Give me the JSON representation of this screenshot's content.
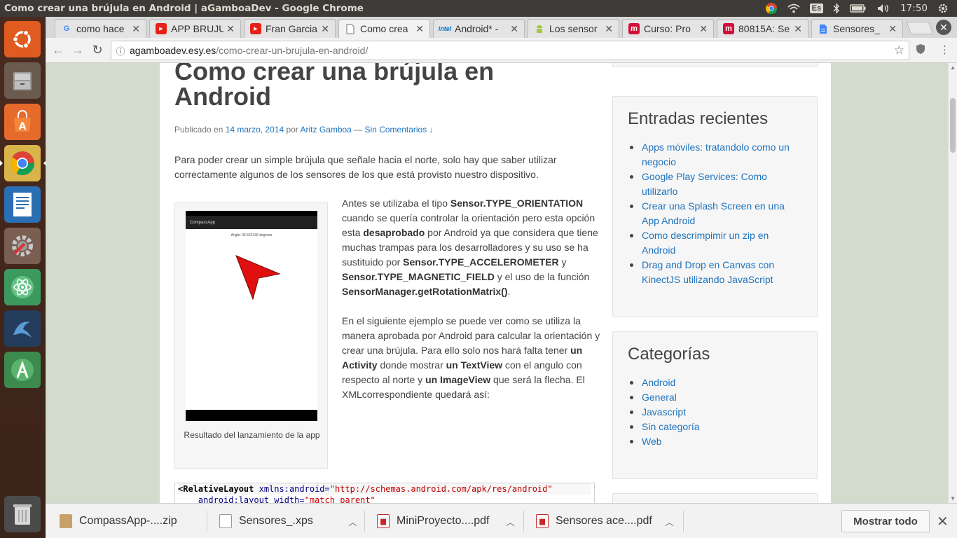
{
  "window": {
    "title": "Como crear una brújula en Android | aGamboaDev - Google Chrome"
  },
  "panel": {
    "keyboard_layout": "Es",
    "time": "17:50"
  },
  "launcher": {
    "apps": [
      {
        "name": "ubuntu-dash-icon"
      },
      {
        "name": "files-icon"
      },
      {
        "name": "software-center-icon"
      },
      {
        "name": "chrome-icon"
      },
      {
        "name": "libreoffice-writer-icon"
      },
      {
        "name": "system-settings-icon"
      },
      {
        "name": "atom-icon"
      },
      {
        "name": "mysql-workbench-icon"
      },
      {
        "name": "android-studio-icon"
      },
      {
        "name": "trash-icon"
      }
    ]
  },
  "tabs": [
    {
      "label": "como hace",
      "icon": "google-icon",
      "color": "#4285f4"
    },
    {
      "label": "APP BRUJU",
      "icon": "youtube-icon",
      "color": "#e62117"
    },
    {
      "label": "Fran Garcia",
      "icon": "youtube-icon",
      "color": "#e62117"
    },
    {
      "label": "Como crea",
      "icon": "page-icon",
      "color": "#777777",
      "active": true
    },
    {
      "label": "Android* -",
      "icon": "intel-icon",
      "color": "#0071c5"
    },
    {
      "label": "Los sensor",
      "icon": "android-icon",
      "color": "#a4c639"
    },
    {
      "label": "Curso: Pro",
      "icon": "m-icon",
      "color": "#d0103a"
    },
    {
      "label": "80815A: Se",
      "icon": "m-icon",
      "color": "#d0103a"
    },
    {
      "label": "Sensores_",
      "icon": "doc-icon",
      "color": "#4285f4"
    }
  ],
  "omnibox": {
    "host": "agamboadev.esy.es",
    "path": "/como-crear-un-brujula-en-android/"
  },
  "post": {
    "title": "Como crear una brújula en Android",
    "meta_prefix": "Publicado en ",
    "date": "14 marzo, 2014",
    "meta_by": " por ",
    "author": "Aritz Gamboa",
    "meta_sep": " — ",
    "comments": "Sin Comentarios ↓",
    "intro": "Para poder crear un simple brújula que señale hacia el norte, solo hay que saber utilizar correctamente algunos de los sensores de los que está provisto nuestro dispositivo.",
    "figure": {
      "app_title": "CompassApp",
      "angle_text": "Angle: 42.642136 degrees",
      "caption": "Resultado del lanzamiento de la app"
    },
    "p1": [
      {
        "t": "Antes se utilizaba el tipo "
      },
      {
        "b": "Sensor.TYPE_ORIENTATION"
      },
      {
        "t": " cuando se quería controlar la orientación pero esta opción esta "
      },
      {
        "b": "desaprobado"
      },
      {
        "t": " por Android ya que considera que tiene muchas trampas para los desarrolladores y su uso se ha sustituido por "
      },
      {
        "b": "Sensor.TYPE_ACCELEROMETER"
      },
      {
        "t": " y "
      },
      {
        "b": "Sensor.TYPE_MAGNETIC_FIELD"
      },
      {
        "t": " y el uso de la función "
      },
      {
        "b": "SensorManager.getRotationMatrix()"
      },
      {
        "t": "."
      }
    ],
    "p2": [
      {
        "t": "En el siguiente ejemplo se puede ver como se utiliza la manera aprobada por Android para calcular la orientación y crear una brújula. Para ello solo nos hará falta tener "
      },
      {
        "b": "un Activity"
      },
      {
        "t": " donde mostrar "
      },
      {
        "b": "un TextView"
      },
      {
        "t": " con el angulo con respecto al norte y "
      },
      {
        "b": "un ImageView"
      },
      {
        "t": " que será la flecha. El XMLcorrespondiente quedará así:"
      }
    ],
    "code": {
      "line1_tag": "<RelativeLayout",
      "line1_attr": " xmlns:android=",
      "line1_val": "\"http://schemas.android.com/apk/res/android\"",
      "line2_attr": "    android:layout_width=",
      "line2_val": "\"match_parent\""
    }
  },
  "sidebar": {
    "recent_title": "Entradas recientes",
    "recent": [
      "Apps móviles: tratandolo como un negocio",
      "Google Play Services: Como utilizarlo",
      "Crear una Splash Screen en una App Android",
      "Como descrimpimir un zip en Android",
      "Drag and Drop en Canvas con KinectJS utilizando JavaScript"
    ],
    "categories_title": "Categorías",
    "categories": [
      "Android",
      "General",
      "Javascript",
      "Sin categoría",
      "Web"
    ]
  },
  "downloads": {
    "items": [
      {
        "name": "CompassApp-....zip",
        "icon": "zip-file-icon",
        "color": "#c8a06a"
      },
      {
        "name": "Sensores_.xps",
        "icon": "file-icon",
        "color": "#ffffff"
      },
      {
        "name": "MiniProyecto....pdf",
        "icon": "pdf-icon",
        "color": "#c62828"
      },
      {
        "name": "Sensores ace....pdf",
        "icon": "pdf-icon",
        "color": "#c62828"
      }
    ],
    "show_all": "Mostrar todo"
  }
}
